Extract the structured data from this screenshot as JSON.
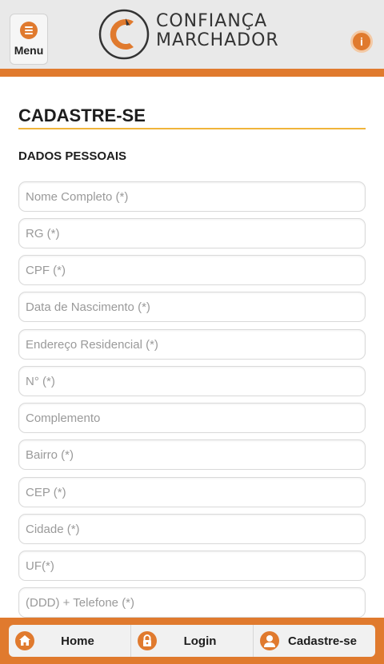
{
  "header": {
    "menu_label": "Menu",
    "logo_line1": "CONFIANÇA",
    "logo_line2": "MARCHADOR",
    "info_icon": "info-icon",
    "accent_color": "#e07a2e"
  },
  "page": {
    "title": "CADASTRE-SE",
    "section_title": "DADOS PESSOAIS"
  },
  "form": {
    "fields": [
      {
        "placeholder": "Nome Completo (*)",
        "value": ""
      },
      {
        "placeholder": "RG (*)",
        "value": ""
      },
      {
        "placeholder": "CPF (*)",
        "value": ""
      },
      {
        "placeholder": "Data de Nascimento (*)",
        "value": ""
      },
      {
        "placeholder": "Endereço Residencial (*)",
        "value": ""
      },
      {
        "placeholder": "N° (*)",
        "value": ""
      },
      {
        "placeholder": "Complemento",
        "value": ""
      },
      {
        "placeholder": "Bairro (*)",
        "value": ""
      },
      {
        "placeholder": "CEP (*)",
        "value": ""
      },
      {
        "placeholder": "Cidade (*)",
        "value": ""
      },
      {
        "placeholder": "UF(*)",
        "value": ""
      },
      {
        "placeholder": "(DDD) + Telefone (*)",
        "value": ""
      }
    ]
  },
  "footer": {
    "tabs": [
      {
        "label": "Home",
        "icon": "home-icon"
      },
      {
        "label": "Login",
        "icon": "lock-icon"
      },
      {
        "label": "Cadastre-se",
        "icon": "user-icon"
      }
    ]
  }
}
